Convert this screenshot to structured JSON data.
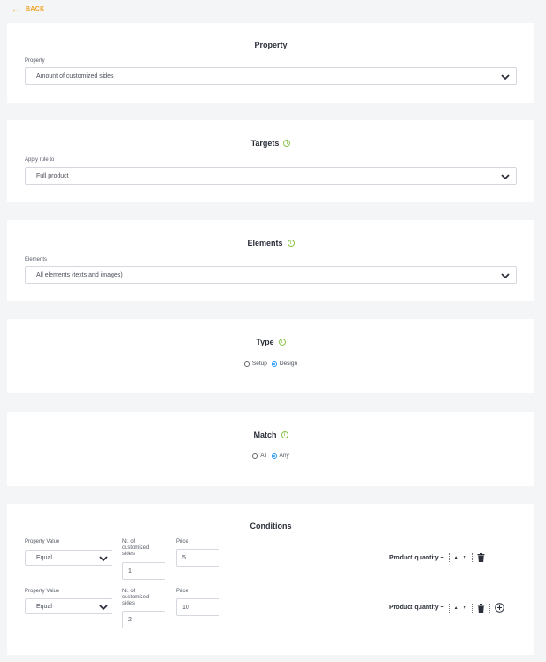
{
  "back": {
    "label": "BACK",
    "icon": "arrow-left-icon"
  },
  "property": {
    "title": "Property",
    "field_label": "Property",
    "value": "Amount of customized sides"
  },
  "targets": {
    "title": "Targets",
    "field_label": "Apply rule to",
    "value": "Full product"
  },
  "elements": {
    "title": "Elements",
    "field_label": "Elements",
    "value": "All elements (texts and images)"
  },
  "type": {
    "title": "Type",
    "options": [
      {
        "label": "Setup",
        "checked": false
      },
      {
        "label": "Design",
        "checked": true
      }
    ]
  },
  "match": {
    "title": "Match",
    "options": [
      {
        "label": "All",
        "checked": false
      },
      {
        "label": "Any",
        "checked": true
      }
    ]
  },
  "conditions": {
    "title": "Conditions",
    "rows": [
      {
        "property_label": "Property Value",
        "property_value": "Equal",
        "count_label_1": "Nr. of",
        "count_label_2": "customized",
        "count_label_3": "sides",
        "count_value": "1",
        "price_label": "Price",
        "price_value": "5",
        "qty_label": "Product quantity +",
        "has_add": false
      },
      {
        "property_label": "Property Value",
        "property_value": "Equal",
        "count_label_1": "Nr. of",
        "count_label_2": "customized",
        "count_label_3": "sides",
        "count_value": "2",
        "price_label": "Price",
        "price_value": "10",
        "qty_label": "Product quantity +",
        "has_add": true
      }
    ]
  },
  "colors": {
    "accent": "#f0a020",
    "info": "#8bc34a",
    "radio": "#2196f3"
  }
}
